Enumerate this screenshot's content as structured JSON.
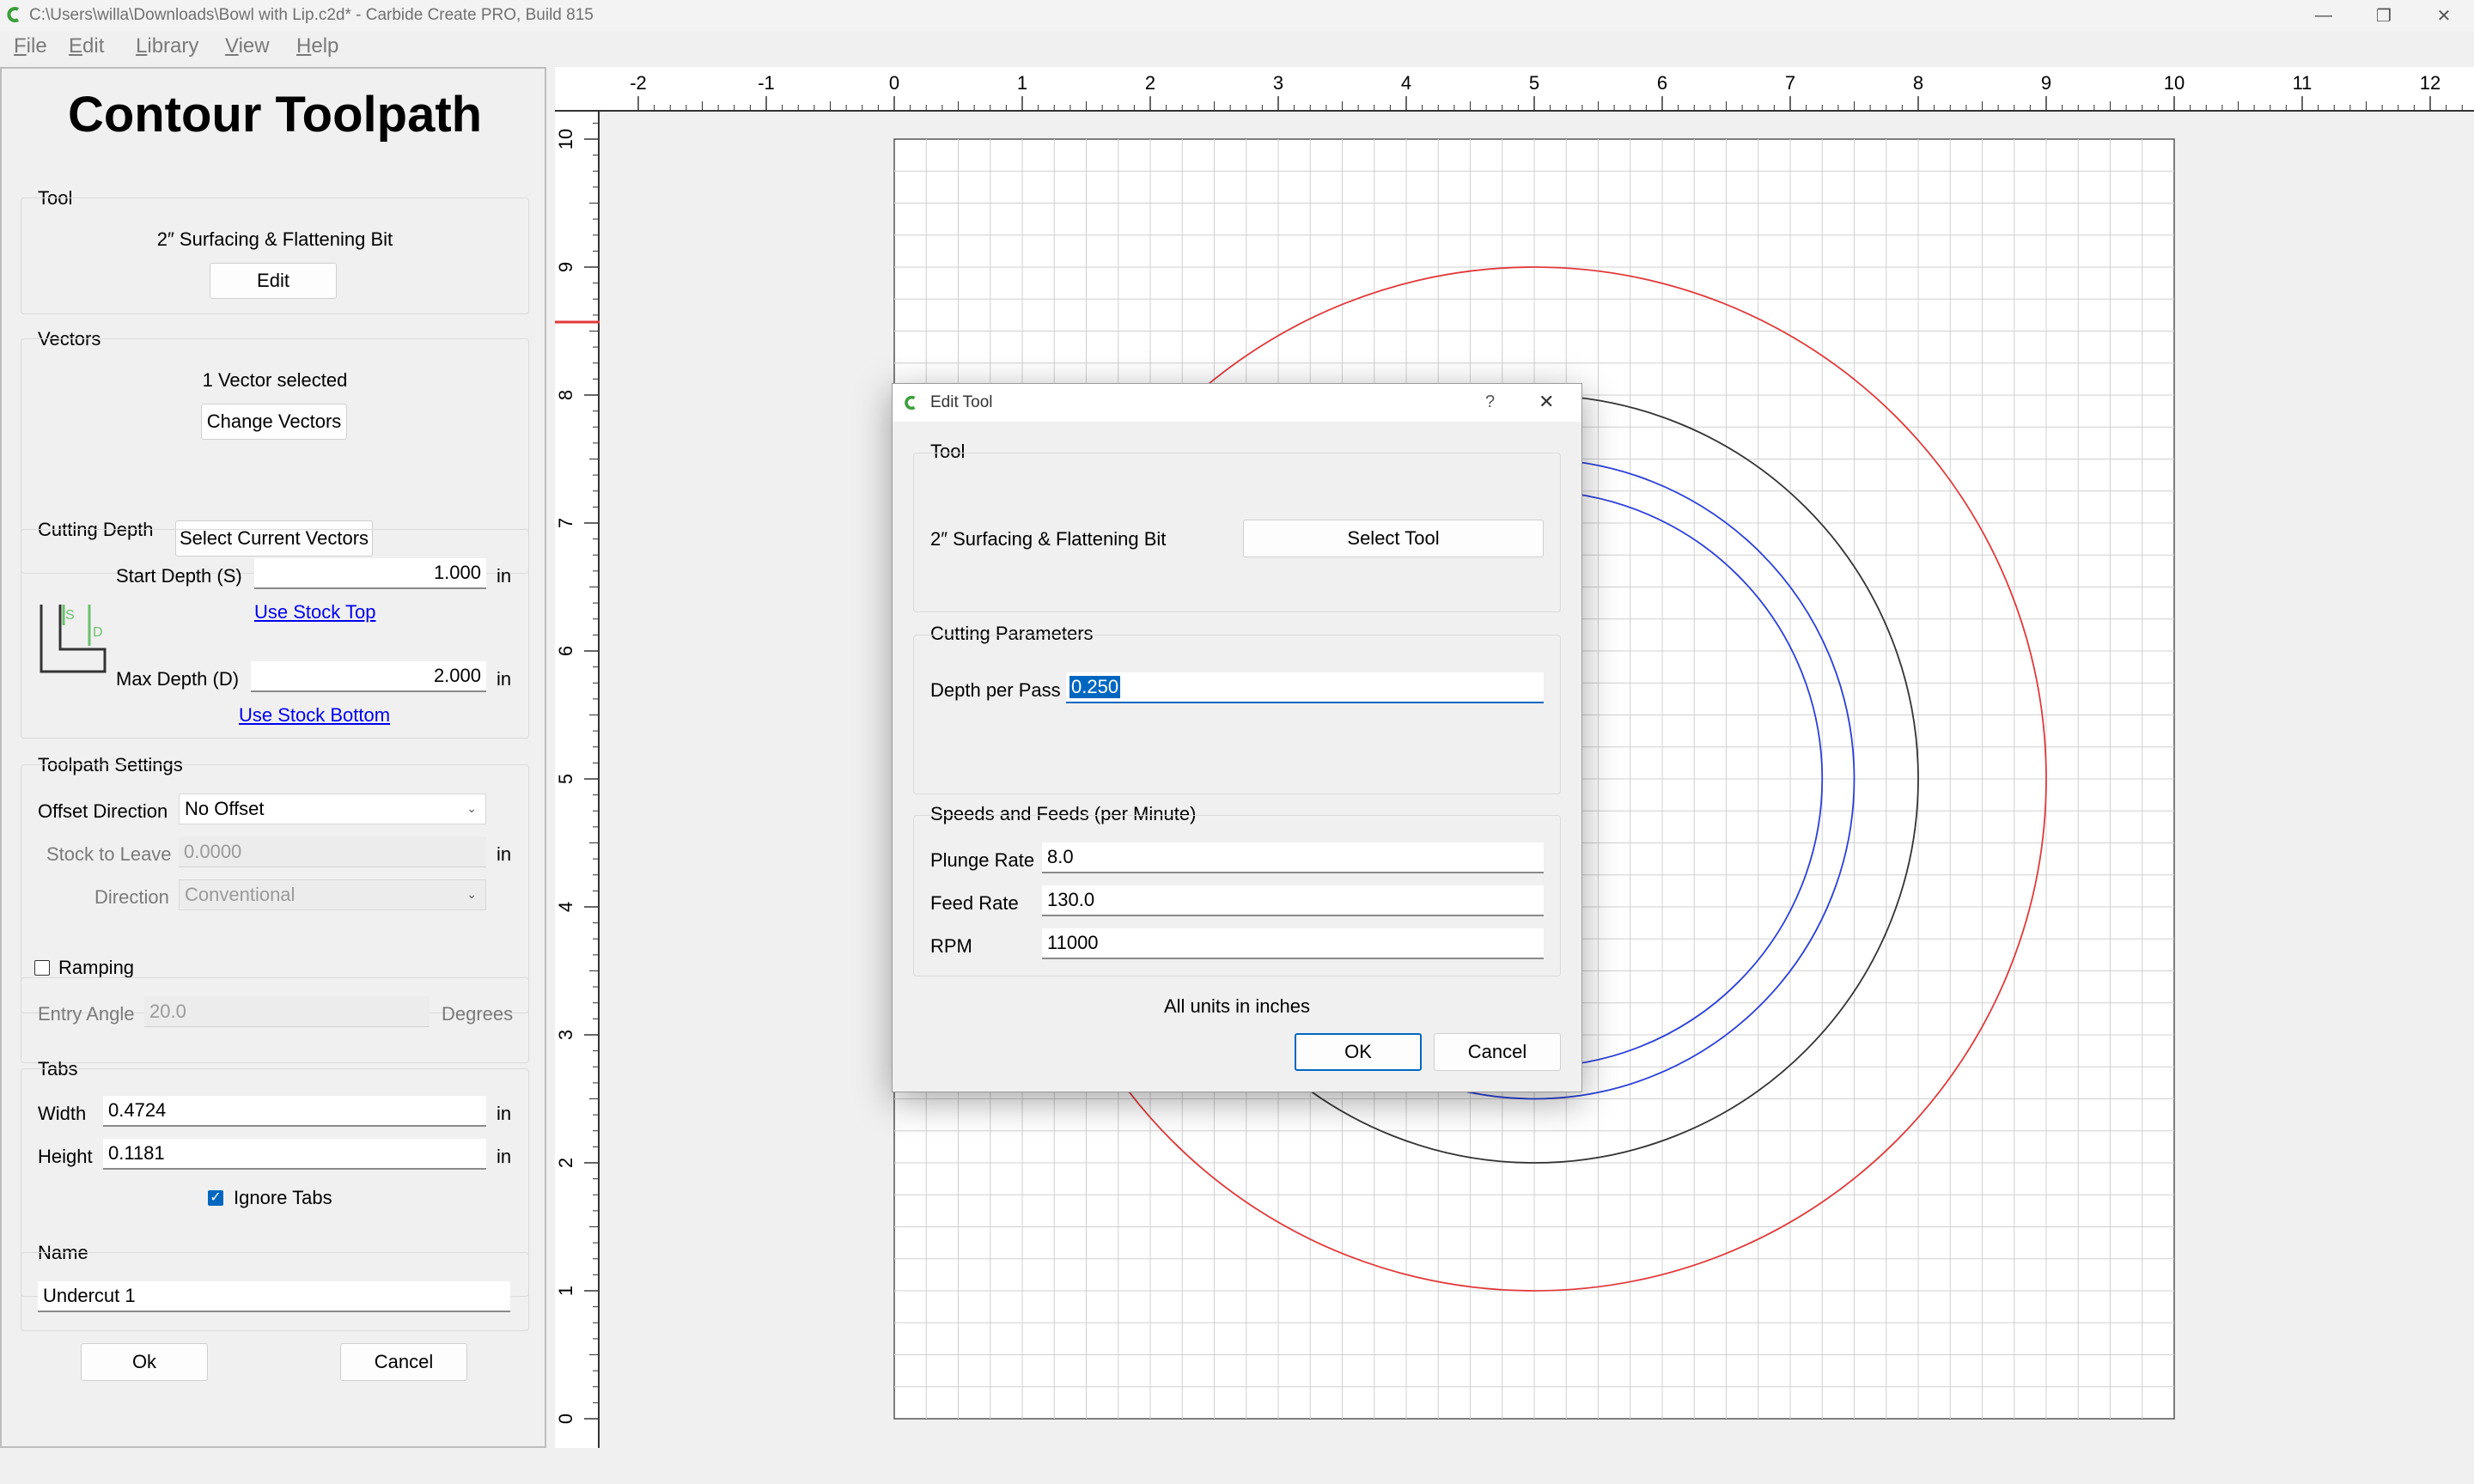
{
  "window": {
    "title": "C:\\Users\\willa\\Downloads\\Bowl with Lip.c2d* - Carbide Create PRO, Build 815",
    "app_icon": "carbide-c-logo",
    "controls": [
      "minimize-icon",
      "restore-icon",
      "close-icon"
    ]
  },
  "menu": [
    {
      "label": "File",
      "first": "F",
      "rest": "ile"
    },
    {
      "label": "Edit",
      "first": "E",
      "rest": "dit"
    },
    {
      "label": "Library",
      "first": "L",
      "rest": "ibrary"
    },
    {
      "label": "View",
      "first": "V",
      "rest": "iew"
    },
    {
      "label": "Help",
      "first": "H",
      "rest": "elp"
    }
  ],
  "panel": {
    "title": "Contour Toolpath",
    "tool": {
      "label": "Tool",
      "name": "2″ Surfacing & Flattening Bit",
      "edit": "Edit"
    },
    "vectors": {
      "label": "Vectors",
      "status": "1 Vector selected",
      "change": "Change Vectors",
      "select_current": "Select Current Vectors"
    },
    "cutting_depth": {
      "label": "Cutting Depth",
      "start_label": "Start Depth (S)",
      "start_value": "1.000",
      "start_unit": "in",
      "use_stock_top": "Use Stock Top",
      "max_label": "Max Depth (D)",
      "max_value": "2.000",
      "max_unit": "in",
      "use_stock_bottom": "Use Stock Bottom",
      "diagram_s": "S",
      "diagram_d": "D"
    },
    "toolpath_settings": {
      "label": "Toolpath Settings",
      "offset_label": "Offset Direction",
      "offset_value": "No Offset",
      "stock_label": "Stock to Leave",
      "stock_value": "0.0000",
      "stock_unit": "in",
      "direction_label": "Direction",
      "direction_value": "Conventional"
    },
    "ramping": {
      "label": "Ramping",
      "checked": false,
      "angle_label": "Entry Angle",
      "angle_value": "20.0",
      "angle_unit": "Degrees"
    },
    "tabs": {
      "label": "Tabs",
      "width_label": "Width",
      "width_value": "0.4724",
      "width_unit": "in",
      "height_label": "Height",
      "height_value": "0.1181",
      "height_unit": "in",
      "ignore_label": "Ignore Tabs",
      "ignore_checked": true
    },
    "name": {
      "label": "Name",
      "value": "Undercut 1"
    },
    "ok": "Ok",
    "cancel": "Cancel"
  },
  "rulers": {
    "x_ticks": [
      "-2",
      "-1",
      "0",
      "1",
      "2",
      "3",
      "4",
      "5",
      "6",
      "7",
      "8",
      "9",
      "10",
      "11",
      "12"
    ],
    "y_ticks": [
      "10",
      "9",
      "8",
      "7",
      "6",
      "5",
      "4",
      "3",
      "2",
      "1",
      "0"
    ]
  },
  "colors": {
    "outer_circle": "#e03a3a",
    "black_circle": "#333333",
    "blue_circle": "#2a3fd8",
    "grid": "#d0d0d0",
    "accent": "#0067c0"
  },
  "dialog": {
    "title": "Edit Tool",
    "help": "?",
    "close": "✕",
    "tool_group": "Tool",
    "tool_name": "2″ Surfacing & Flattening Bit",
    "select_tool": "Select Tool",
    "cutting_group": "Cutting Parameters",
    "depth_label": "Depth per Pass",
    "depth_value": "0.250",
    "speeds_group": "Speeds and Feeds (per Minute)",
    "plunge_label": "Plunge Rate",
    "plunge_value": "8.0",
    "feed_label": "Feed Rate",
    "feed_value": "130.0",
    "rpm_label": "RPM",
    "rpm_value": "11000",
    "units_note": "All units in inches",
    "ok": "OK",
    "cancel": "Cancel"
  }
}
